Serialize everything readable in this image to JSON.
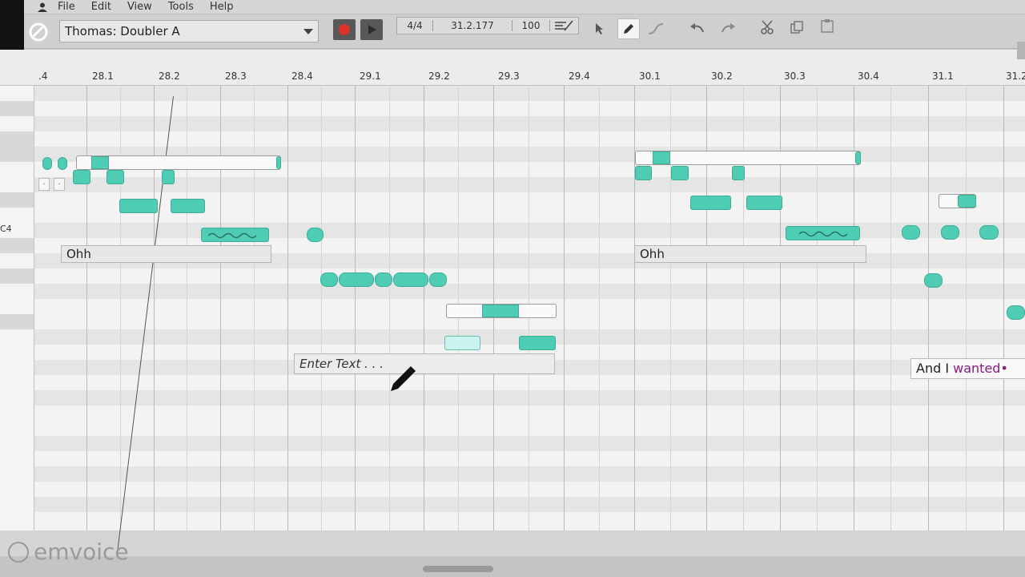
{
  "menu": {
    "items": [
      "File",
      "Edit",
      "View",
      "Tools",
      "Help"
    ]
  },
  "toolbar": {
    "track_name": "Thomas: Doubler A",
    "readout": {
      "time_signature": "4/4",
      "position": "31.2.177",
      "tempo": "100"
    }
  },
  "ruler": {
    "labels": [
      ".4",
      "28.1",
      "28.2",
      "28.3",
      "28.4",
      "29.1",
      "29.2",
      "29.3",
      "29.4",
      "30.1",
      "30.2",
      "30.3",
      "30.4",
      "31.1",
      "31.2"
    ]
  },
  "editor": {
    "key_label": "C4",
    "lyrics": {
      "ohh_1": "Ohh",
      "ohh_2": "Ohh",
      "enter_text": "Enter Text . . .",
      "tail_prefix": "And I ",
      "tail_highlight": "wanted"
    },
    "tiny_marks": [
      ".",
      "."
    ]
  },
  "footer": {
    "brand": "emvoice"
  },
  "colors": {
    "note": "#4ecdb4",
    "note_selected": "#cbf4ef",
    "record": "#d9332b",
    "lyric_highlight": "#8a1b84"
  }
}
